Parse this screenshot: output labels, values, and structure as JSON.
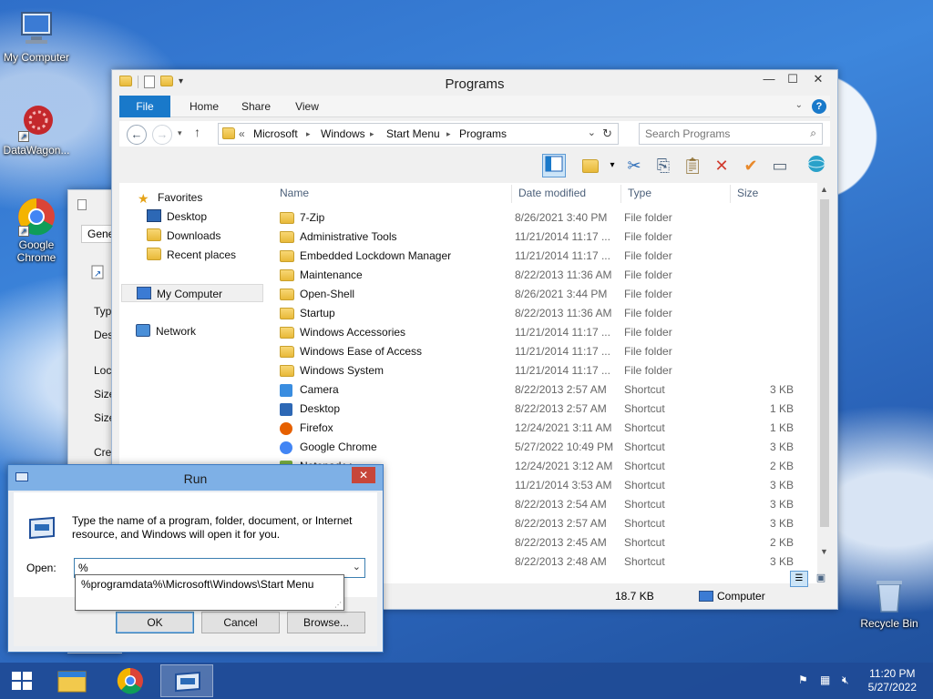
{
  "desktop": {
    "icons": [
      {
        "label": "My Computer"
      },
      {
        "label": "DataWagon..."
      },
      {
        "label": "Google Chrome"
      },
      {
        "label": "Recycle Bin"
      }
    ]
  },
  "explorer": {
    "title": "Programs",
    "tabs": [
      "File",
      "Home",
      "Share",
      "View"
    ],
    "breadcrumb": [
      "«",
      "Microsoft",
      "Windows",
      "Start Menu",
      "Programs"
    ],
    "search_placeholder": "Search Programs",
    "columns": {
      "name": "Name",
      "date": "Date modified",
      "type": "Type",
      "size": "Size"
    },
    "nav": {
      "favorites": "Favorites",
      "desktop": "Desktop",
      "downloads": "Downloads",
      "recent": "Recent places",
      "computer": "My Computer",
      "network": "Network"
    },
    "rows": [
      {
        "name": "7-Zip",
        "date": "8/26/2021 3:40 PM",
        "type": "File folder",
        "size": "",
        "icon": "folder"
      },
      {
        "name": "Administrative Tools",
        "date": "11/21/2014 11:17 ...",
        "type": "File folder",
        "size": "",
        "icon": "folder"
      },
      {
        "name": "Embedded Lockdown Manager",
        "date": "11/21/2014 11:17 ...",
        "type": "File folder",
        "size": "",
        "icon": "folder"
      },
      {
        "name": "Maintenance",
        "date": "8/22/2013 11:36 AM",
        "type": "File folder",
        "size": "",
        "icon": "folder"
      },
      {
        "name": "Open-Shell",
        "date": "8/26/2021 3:44 PM",
        "type": "File folder",
        "size": "",
        "icon": "folder"
      },
      {
        "name": "Startup",
        "date": "8/22/2013 11:36 AM",
        "type": "File folder",
        "size": "",
        "icon": "folder"
      },
      {
        "name": "Windows Accessories",
        "date": "11/21/2014 11:17 ...",
        "type": "File folder",
        "size": "",
        "icon": "folder"
      },
      {
        "name": "Windows Ease of Access",
        "date": "11/21/2014 11:17 ...",
        "type": "File folder",
        "size": "",
        "icon": "folder"
      },
      {
        "name": "Windows System",
        "date": "11/21/2014 11:17 ...",
        "type": "File folder",
        "size": "",
        "icon": "folder"
      },
      {
        "name": "Camera",
        "date": "8/22/2013 2:57 AM",
        "type": "Shortcut",
        "size": "3 KB",
        "icon": "camera"
      },
      {
        "name": "Desktop",
        "date": "8/22/2013 2:57 AM",
        "type": "Shortcut",
        "size": "1 KB",
        "icon": "desktop"
      },
      {
        "name": "Firefox",
        "date": "12/24/2021 3:11 AM",
        "type": "Shortcut",
        "size": "1 KB",
        "icon": "firefox"
      },
      {
        "name": "Google Chrome",
        "date": "5/27/2022 10:49 PM",
        "type": "Shortcut",
        "size": "3 KB",
        "icon": "chrome"
      },
      {
        "name": "Notepad++",
        "date": "12/24/2021 3:12 AM",
        "type": "Shortcut",
        "size": "2 KB",
        "icon": "notepad"
      },
      {
        "name": "",
        "date": "11/21/2014 3:53 AM",
        "type": "Shortcut",
        "size": "3 KB",
        "icon": "generic"
      },
      {
        "name": "",
        "date": "8/22/2013 2:54 AM",
        "type": "Shortcut",
        "size": "3 KB",
        "icon": "generic"
      },
      {
        "name": "",
        "date": "8/22/2013 2:57 AM",
        "type": "Shortcut",
        "size": "3 KB",
        "icon": "generic"
      },
      {
        "name": "",
        "date": "8/22/2013 2:45 AM",
        "type": "Shortcut",
        "size": "2 KB",
        "icon": "generic"
      },
      {
        "name": "",
        "date": "8/22/2013 2:48 AM",
        "type": "Shortcut",
        "size": "3 KB",
        "icon": "generic"
      }
    ],
    "status": {
      "size": "18.7 KB",
      "location": "Computer"
    }
  },
  "props": {
    "tab": "Gener",
    "labels": [
      "Type",
      "Desc",
      "Loca",
      "Size",
      "Size",
      "Crea"
    ]
  },
  "run": {
    "title": "Run",
    "description": "Type the name of a program, folder, document, or Internet resource, and Windows will open it for you.",
    "open_label": "Open:",
    "input_value": "%",
    "suggestion": "%programdata%\\Microsoft\\Windows\\Start Menu",
    "ok": "OK",
    "cancel": "Cancel",
    "browse": "Browse..."
  },
  "taskbar": {
    "time": "11:20 PM",
    "date": "5/27/2022"
  },
  "colors": {
    "accent": "#1979ca",
    "folder": "#e8b939",
    "taskbar": "#204b96"
  }
}
